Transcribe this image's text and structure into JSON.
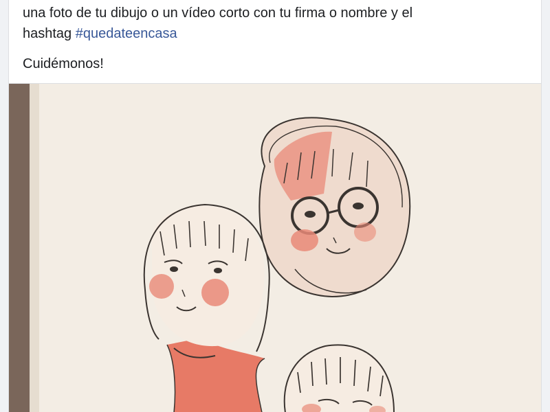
{
  "post": {
    "text_line1": "una foto de tu dibujo o un vídeo corto con tu firma o nombre y el",
    "text_line2_prefix": "hashtag ",
    "hashtag": "#quedateencasa",
    "closing": "Cuidémonos!"
  },
  "photo": {
    "subject": "sketchbook-drawing-of-three-girls",
    "colors": {
      "paper": "#f3ede4",
      "pencil": "#3a3430",
      "blush": "#e98a78",
      "red_fill": "#e77a66",
      "book_edge": "#6b5a4e"
    }
  }
}
